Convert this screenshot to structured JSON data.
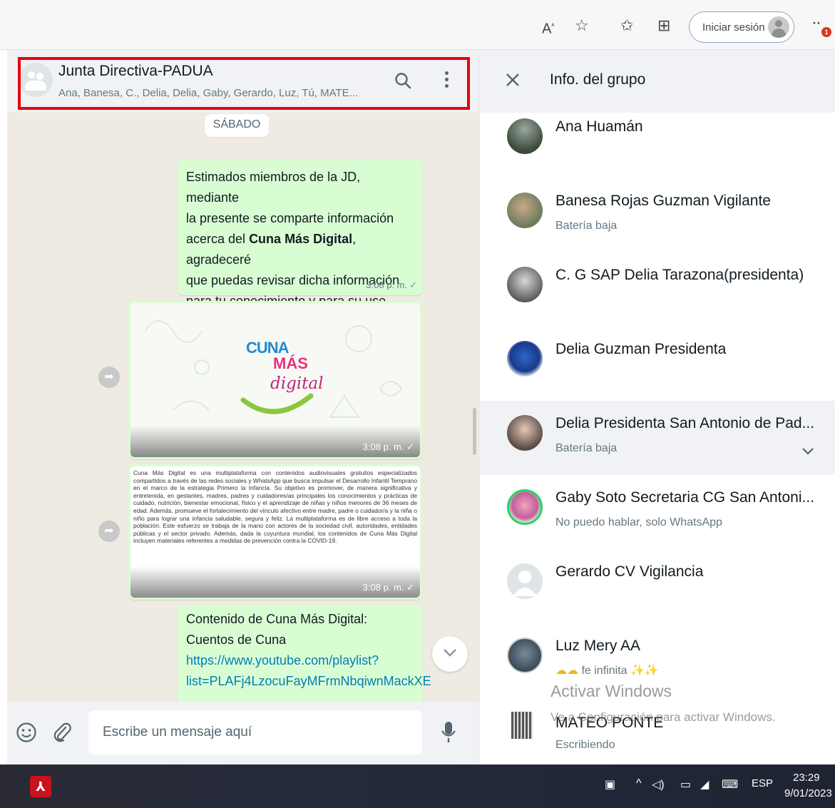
{
  "browser": {
    "signin_label": "Iniciar sesión",
    "notification_count": "1"
  },
  "chat": {
    "title": "Junta Directiva-PADUA",
    "participants": "Ana, Banesa, C., Delia, Delia, Gaby, Gerardo, Luz, Tú, MATE...",
    "date_chip": "SÁBADO",
    "message1": {
      "line1": "Estimados  miembros de la JD,  mediante",
      "line2": "la presente se comparte información",
      "line3_pre": "acerca del ",
      "line3_bold": "Cuna Más Digital",
      "line3_post": ", agradeceré",
      "line4": "que  puedas revisar dicha información",
      "line5": "para tu conocimiento  y para su uso.",
      "time": "3:08 p. m."
    },
    "image_message": {
      "logo_word1": "CUNA",
      "logo_word2": "MÁS",
      "logo_word3": "digital",
      "time": "3:08 p. m."
    },
    "text_image_message": {
      "body": "Cuna Más Digital es una multiplataforma con contenidos audiovisuales gratuitos especializados compartidos a través de las redes sociales y WhatsApp que busca impulsar el Desarrollo Infantil Temprano en el marco de la estrategia Primero la Infancia. Su objetivo es promover, de manera significativa y entretenida, en gestantes, madres, padres y cuidadores/as principales los conocimientos y prácticas de cuidado, nutrición, bienestar emocional, físico y el aprendizaje de niñas y niños menores de 36 meses de edad. Además, promueve el fortalecimiento del vínculo afectivo entre madre, padre o cuidador/a y la niña o niño para lograr una infancia saludable, segura y feliz. La multiplataforma es de libre acceso a toda la población. Este esfuerzo se trabaja de la mano con actores de la sociedad civil, autoridades, entidades públicas y el sector privado. Además, dada la coyuntura mundial, los contenidos de Cuna Más Digital incluyen materiales referentes a medidas de prevención contra la COVID-19.",
      "time": "3:08 p. m."
    },
    "message4": {
      "line1": "Contenido de Cuna Más Digital:",
      "line2": "Cuentos de Cuna",
      "link1": "https://www.youtube.com/playlist?",
      "link2": "list=PLAFj4LzocuFayMFrmNbqiwnMackXE"
    },
    "composer_placeholder": "Escribe un mensaje aquí"
  },
  "info": {
    "title": "Info. del grupo",
    "members": [
      {
        "name": "Ana Huamán",
        "status": ""
      },
      {
        "name": "Banesa Rojas Guzman Vigilante",
        "status": "Batería baja"
      },
      {
        "name": "C. G SAP Delia Tarazona(presidenta)",
        "status": ""
      },
      {
        "name": "Delia Guzman Presidenta",
        "status": ""
      },
      {
        "name": "Delia Presidenta San Antonio de Pad...",
        "status": "Batería baja"
      },
      {
        "name": "Gaby Soto Secretaria CG San Antoni...",
        "status": "No puedo hablar, solo WhatsApp"
      },
      {
        "name": "Gerardo CV Vigilancia",
        "status": ""
      },
      {
        "name": "Luz Mery AA",
        "status": "fe infinita"
      },
      {
        "name": "MATEO PONTE",
        "status": "Escribiendo"
      }
    ]
  },
  "watermark": {
    "title": "Activar Windows",
    "subtitle": "Ve a Configuración para activar Windows."
  },
  "taskbar": {
    "language": "ESP",
    "time": "23:29",
    "date": "9/01/2023"
  },
  "colors": {
    "highlight": "#e8000b",
    "bubble_green": "#d9fdd3",
    "chat_bg": "#efeae2",
    "link": "#027eb5"
  }
}
